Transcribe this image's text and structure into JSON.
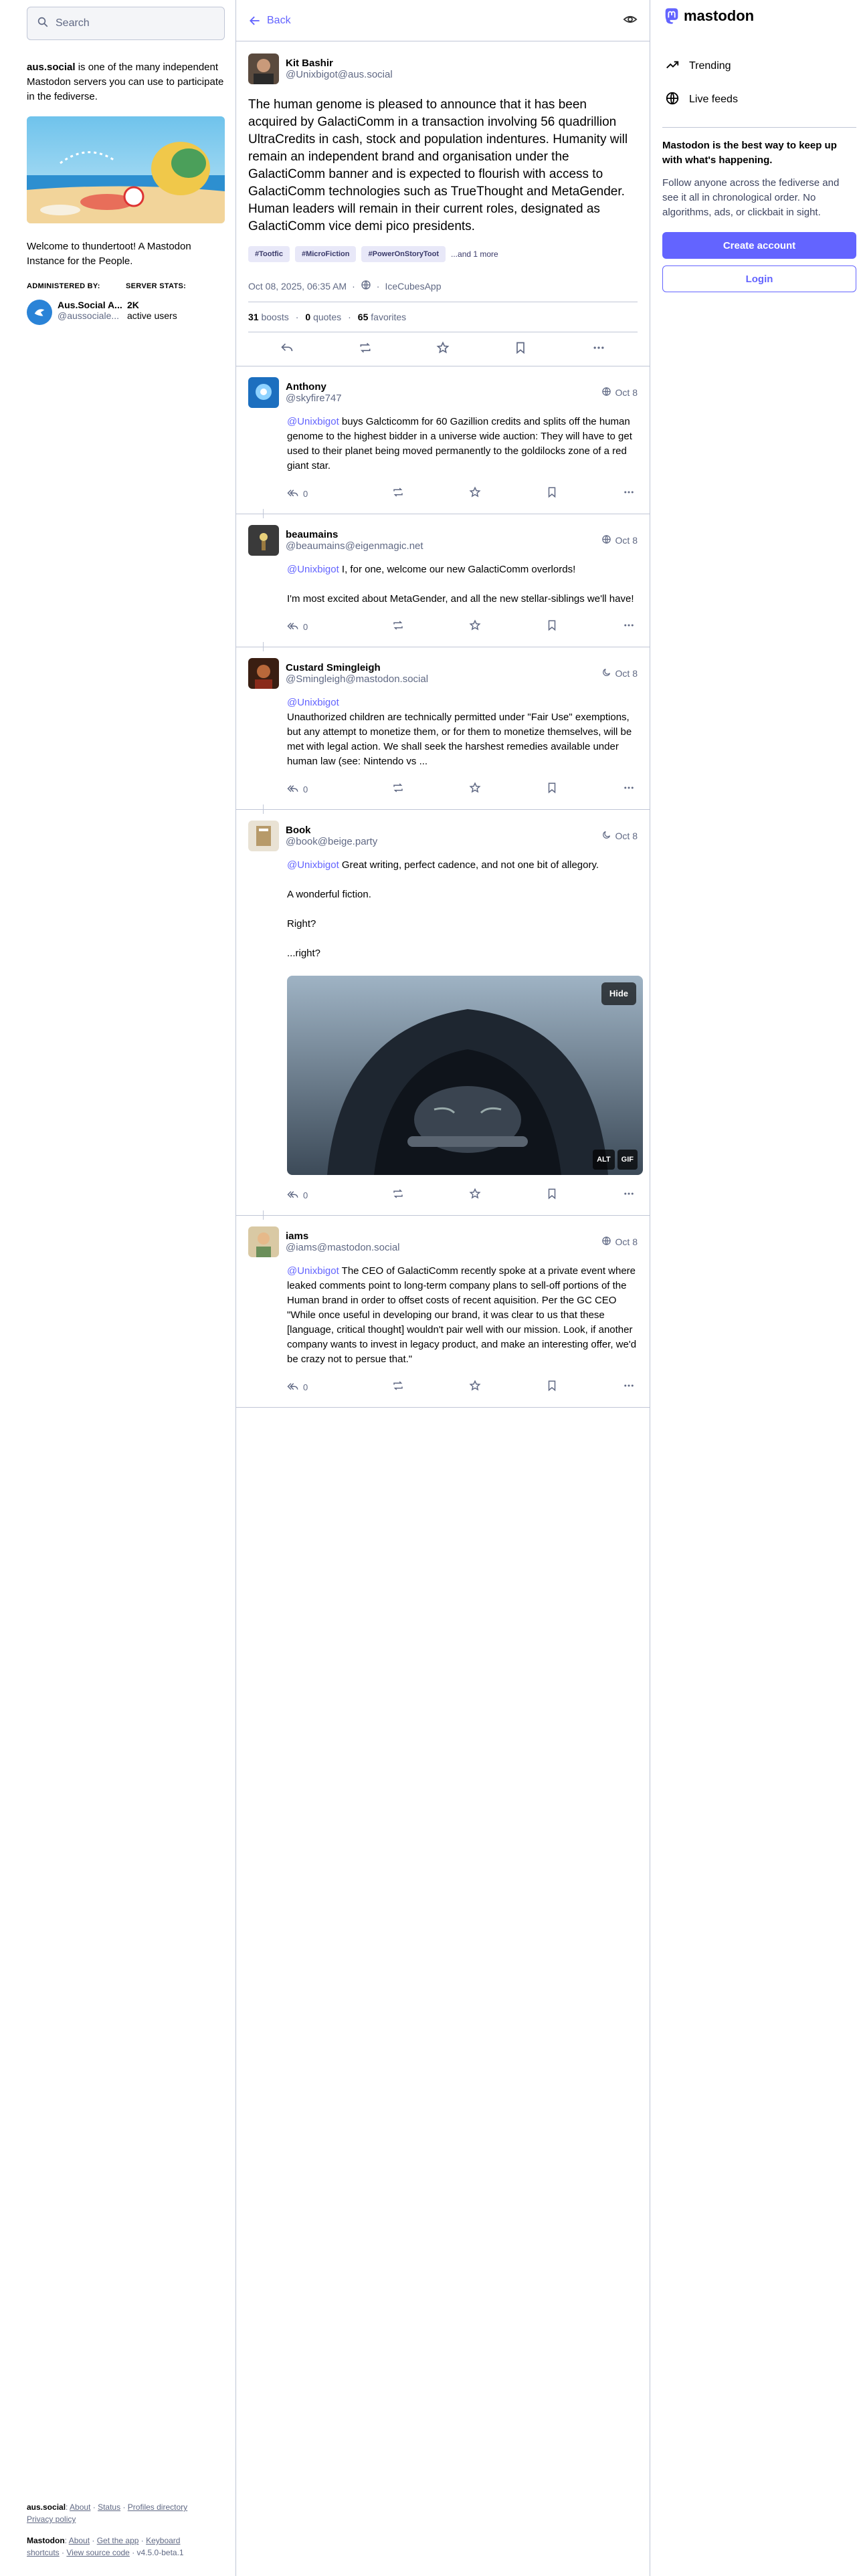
{
  "search": {
    "placeholder": "Search"
  },
  "about": {
    "server": "aus.social",
    "text": " is one of the many independent Mastodon servers you can use to participate in the fediverse.",
    "welcome": "Welcome to thundertoot! A Mastodon Instance for the People.",
    "administered_by_label": "ADMINISTERED BY:",
    "server_stats_label": "SERVER STATS:",
    "admin_name": "Aus.Social A...",
    "admin_handle": "@aussociale...",
    "active_users_count": "2K",
    "active_users_label": "active users"
  },
  "left_footer": {
    "server": "aus.social",
    "links1": [
      "About",
      "Status",
      "Profiles directory",
      "Privacy policy"
    ],
    "product": "Mastodon",
    "links2": [
      "About",
      "Get the app",
      "Keyboard shortcuts",
      "View source code"
    ],
    "version": "v4.5.0-beta.1"
  },
  "header": {
    "back_label": "Back"
  },
  "main_status": {
    "name": "Kit Bashir",
    "handle": "@Unixbigot@aus.social",
    "text": "The human genome is pleased to announce that it has been acquired by GalactiComm in a transaction involving 56 quadrillion UltraCredits in cash, stock and population indentures.   Humanity will remain an independent brand and organisation under the GalactiComm banner and is expected to flourish with access to GalactiComm technologies such as TrueThought and MetaGender. Human leaders will remain in their current roles, designated as GalactiComm vice demi pico presidents.",
    "tags": [
      "#Tootfic",
      "#MicroFiction",
      "#PowerOnStoryToot"
    ],
    "more_tags": "...and 1 more",
    "date": "Oct 08, 2025, 06:35 AM",
    "app": "IceCubesApp",
    "boosts": "31",
    "boosts_label": "boosts",
    "quotes": "0",
    "quotes_label": "quotes",
    "favorites": "65",
    "favorites_label": "favorites"
  },
  "replies": [
    {
      "name": "Anthony",
      "handle": "@skyfire747",
      "date": "Oct 8",
      "mention": "@Unixbigot",
      "paragraphs": [
        " buys Galcticomm for 60 Gazillion credits and splits off the human genome to the highest bidder in a universe wide auction: They will have to get used to their planet being moved permanently to the goldilocks zone of a red giant star."
      ],
      "reply_count": "0"
    },
    {
      "name": "beaumains",
      "handle": "@beaumains@eigenmagic.net",
      "date": "Oct 8",
      "mention": "@Unixbigot",
      "paragraphs": [
        " I, for one, welcome our new GalactiComm overlords!",
        "I'm most excited about MetaGender, and all the new stellar-siblings we'll have!"
      ],
      "reply_count": "0"
    },
    {
      "name": "Custard Smingleigh",
      "handle": "@Smingleigh@mastodon.social",
      "date": "Oct 8",
      "mention": "@Unixbigot",
      "paragraphs": [
        "Unauthorized children are technically permitted under \"Fair Use\" exemptions, but any attempt to monetize them, or for them to monetize themselves, will be met with legal action. We shall seek the harshest remedies available under human law (see: Nintendo vs ..."
      ],
      "reply_count": "0"
    },
    {
      "name": "Book",
      "handle": "@book@beige.party",
      "date": "Oct 8",
      "mention": "@Unixbigot",
      "paragraphs": [
        " Great writing, perfect cadence, and not one bit of allegory.",
        "A wonderful fiction.",
        "Right?",
        "...right?"
      ],
      "media": {
        "hide_label": "Hide",
        "alt_label": "ALT",
        "gif_label": "GIF"
      },
      "reply_count": "0"
    },
    {
      "name": "iams",
      "handle": "@iams@mastodon.social",
      "date": "Oct 8",
      "mention": "@Unixbigot",
      "paragraphs": [
        " The CEO of GalactiComm recently spoke at a private event where leaked comments point to long-term company plans to sell-off portions of the Human brand in order to offset costs of recent aquisition. Per the GC CEO \"While once useful in developing our brand, it was clear to us that these [language, critical thought] wouldn't pair well with our mission. Look, if another company wants to invest in legacy product, and make an interesting offer, we'd be crazy not to persue that.\""
      ],
      "reply_count": "0"
    }
  ],
  "right": {
    "logo": "mastodon",
    "nav": [
      "Trending",
      "Live feeds"
    ],
    "pitch_head": "Mastodon is the best way to keep up with what's happening.",
    "pitch_body": "Follow anyone across the fediverse and see it all in chronological order. No algorithms, ads, or clickbait in sight.",
    "create_account": "Create account",
    "login": "Login"
  },
  "colors": {
    "accent": "#6364ff",
    "muted": "#606984",
    "border": "#c0c6d6"
  }
}
